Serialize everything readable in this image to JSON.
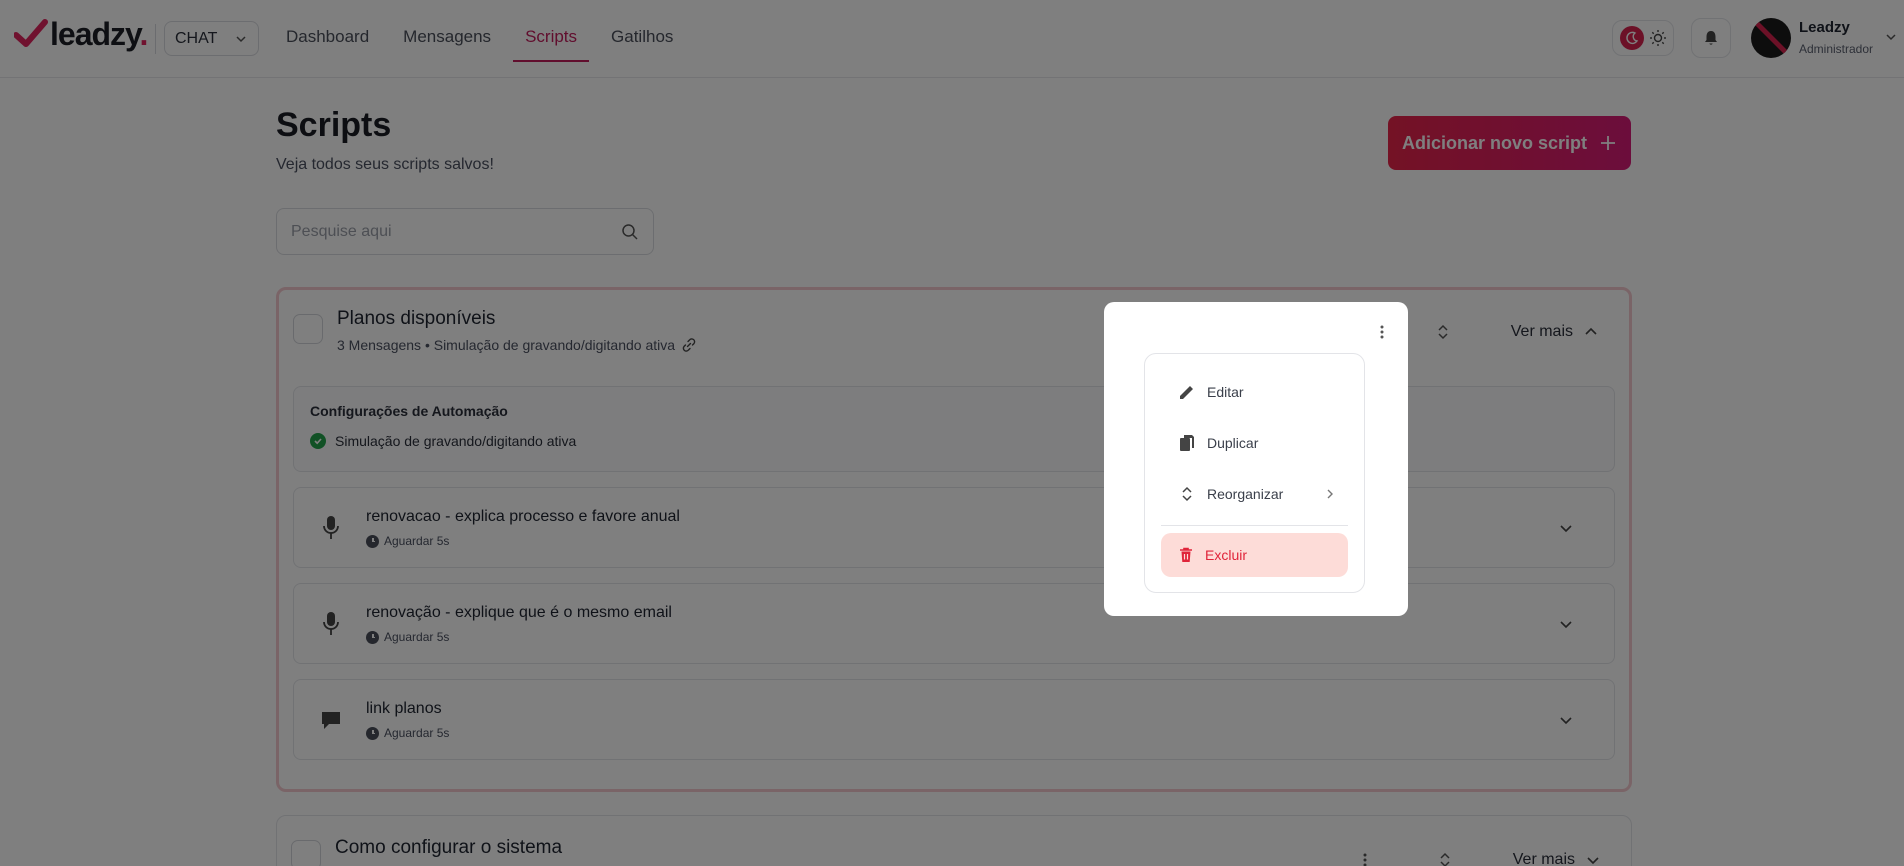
{
  "brand": {
    "name": "leadzy",
    "dot": ".",
    "accent": "#c21d5c"
  },
  "product_select": {
    "value": "CHAT"
  },
  "nav": {
    "items": [
      "Dashboard",
      "Mensagens",
      "Scripts",
      "Gatilhos"
    ],
    "active": "Scripts"
  },
  "user": {
    "name": "Leadzy",
    "role": "Administrador",
    "avatar_text": "leadzy"
  },
  "page": {
    "title": "Scripts",
    "subtitle": "Veja todos seus scripts salvos!",
    "add_button": "Adicionar novo script"
  },
  "search": {
    "placeholder": "Pesquise aqui"
  },
  "scripts": [
    {
      "title": "Planos disponíveis",
      "meta": "3 Mensagens • Simulação de gravando/digitando ativa",
      "ver_mais": "Ver mais",
      "automation": {
        "title": "Configurações de Automação",
        "item": "Simulação de gravando/digitando ativa"
      },
      "messages": [
        {
          "icon": "microphone-icon",
          "title": "renovacao - explica processo e favore anual",
          "wait": "Aguardar 5s"
        },
        {
          "icon": "microphone-icon",
          "title": "renovação - explique que é o mesmo email",
          "wait": "Aguardar 5s"
        },
        {
          "icon": "chat-bubble-icon",
          "title": "link planos",
          "wait": "Aguardar 5s"
        }
      ]
    },
    {
      "title": "Como configurar o sistema",
      "ver_mais": "Ver mais"
    }
  ],
  "context_menu": {
    "items": [
      {
        "icon": "pencil-icon",
        "label": "Editar"
      },
      {
        "icon": "copy-icon",
        "label": "Duplicar"
      },
      {
        "icon": "sort-icon",
        "label": "Reorganizar"
      }
    ],
    "danger": {
      "icon": "trash-icon",
      "label": "Excluir"
    }
  }
}
